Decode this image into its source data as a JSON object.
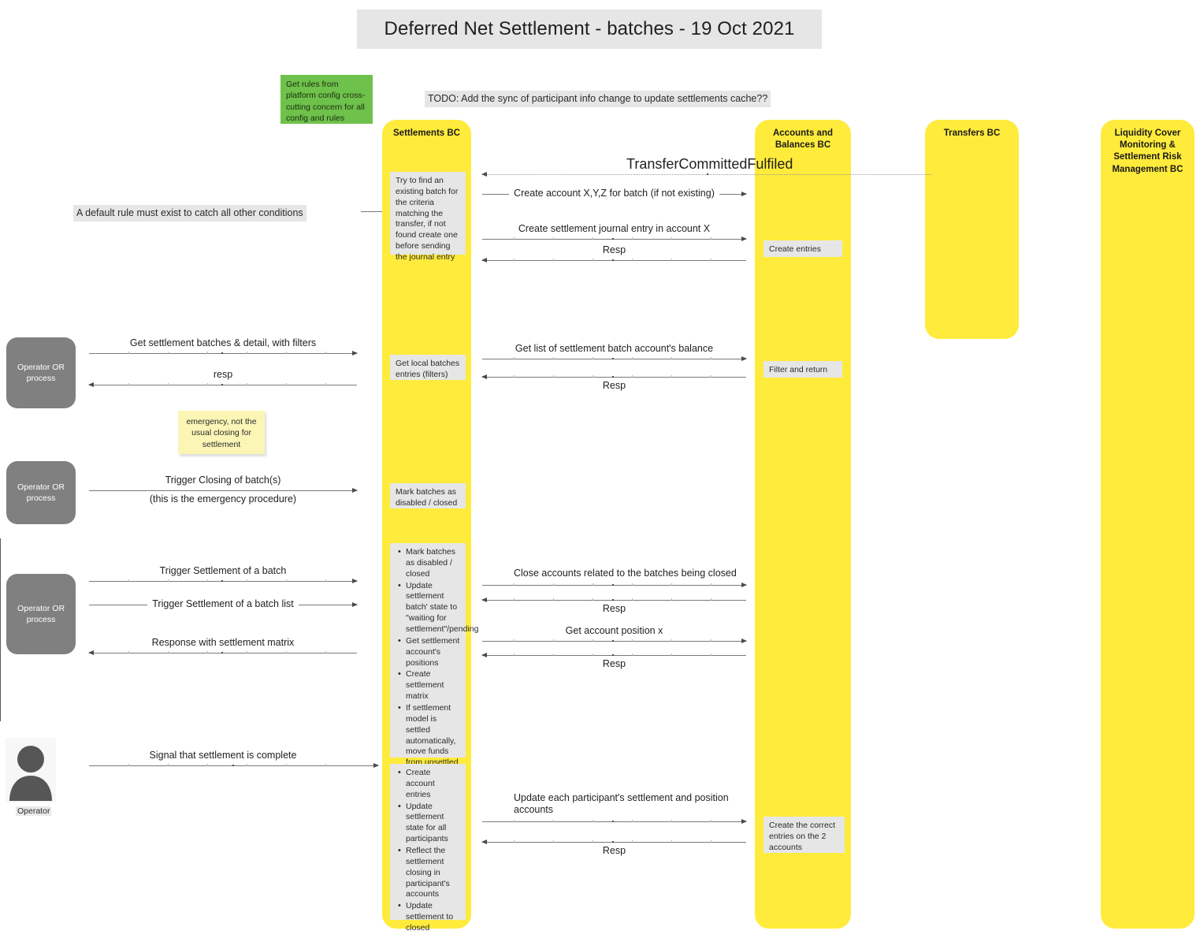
{
  "title": "Deferred Net Settlement - batches - 19 Oct 2021",
  "todo_note": "TODO: Add the sync of participant info change to update settlements cache??",
  "default_rule_note": "A default rule must exist to catch all other conditions",
  "green_note": "Get rules from platform config cross-cutting concern for all config and rules",
  "sticky_note": "emergency, not the usual closing for settlement",
  "event_label": "TransferCommittedFulfiled",
  "lifelines": [
    {
      "id": "settlements",
      "title": "Settlements BC"
    },
    {
      "id": "accounts",
      "title": "Accounts and Balances BC"
    },
    {
      "id": "transfers",
      "title": "Transfers BC"
    },
    {
      "id": "liquidity",
      "title": "Liquidity Cover Monitoring & Settlement Risk Management BC"
    }
  ],
  "actors": [
    {
      "id": "op1",
      "label": "Operator OR process"
    },
    {
      "id": "op2",
      "label": "Operator OR process"
    },
    {
      "id": "op3",
      "label": "Operator OR process"
    },
    {
      "id": "op4",
      "label": "Operator"
    }
  ],
  "notes": {
    "try_find_batch": "Try to find an existing batch for the criteria matching the transfer, if not found create one before sending the journal entry",
    "get_local_batches": "Get local batches entries (filters)",
    "mark_batches": "Mark batches as disabled / closed",
    "create_entries": "Create entries",
    "filter_and_return": "Filter and return",
    "create_correct_entries": "Create the correct entries on the 2 accounts",
    "settlement_steps": [
      "Mark batches as disabled / closed",
      "Update settlement batch' state to \"waiting for settlement\"/pending",
      "Get settlement account's positions",
      "Create settlement matrix",
      "If settlement model is settled automatically, move funds from unsettled to settled accounts"
    ],
    "closing_steps": [
      "Create account entries",
      "Update settlement state for all participants",
      "Reflect the settlement closing in participant's accounts",
      "Update settlement to closed"
    ]
  },
  "messages": {
    "create_account": "Create account  X,Y,Z for batch (if not existing)",
    "create_journal_entry": "Create settlement journal entry in account X",
    "resp1": "Resp",
    "get_batches": "Get settlement batches & detail, with filters",
    "resp_batches": "resp",
    "get_balance_list": "Get list of settlement batch account's balance",
    "resp2": "Resp",
    "trigger_closing": "Trigger Closing of batch(s)",
    "trigger_closing_sub": "(this is the emergency procedure)",
    "trigger_settlement_batch": "Trigger Settlement of a batch",
    "trigger_settlement_list": "Trigger Settlement of a batch list",
    "response_matrix": "Response with settlement matrix",
    "close_accounts": "Close accounts related to the batches being closed",
    "resp3": "Resp",
    "get_account_position": "Get account position x",
    "resp4": "Resp",
    "signal_complete": "Signal that settlement is complete",
    "update_participant": "Update each participant's settlement and position accounts",
    "resp5": "Resp"
  },
  "colors": {
    "lifeline": "#ffeb3b",
    "note": "#e6e6e6",
    "green_note": "#6ec14a",
    "sticky": "#fbf6b6",
    "actor": "#808080"
  }
}
